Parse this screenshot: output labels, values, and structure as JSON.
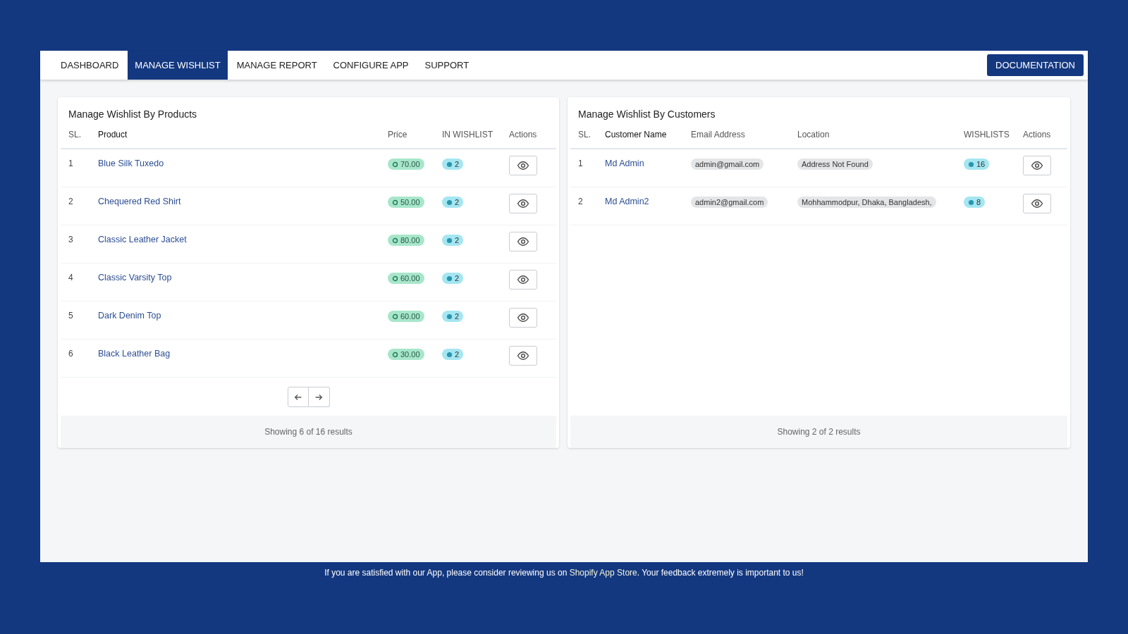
{
  "nav": {
    "tabs": [
      {
        "label": "DASHBOARD",
        "selected": false
      },
      {
        "label": "MANAGE WISHLIST",
        "selected": true
      },
      {
        "label": "MANAGE REPORT",
        "selected": false
      },
      {
        "label": "CONFIGURE APP",
        "selected": false
      },
      {
        "label": "SUPPORT",
        "selected": false
      }
    ],
    "documentation_button": "DOCUMENTATION"
  },
  "products_card": {
    "title": "Manage Wishlist By Products",
    "columns": [
      "SL.",
      "Product",
      "Price",
      "IN WISHLIST",
      "Actions"
    ],
    "rows": [
      {
        "sl": "1",
        "product": "Blue Silk Tuxedo",
        "price": "70.00",
        "in_wishlist": "2"
      },
      {
        "sl": "2",
        "product": "Chequered Red Shirt",
        "price": "50.00",
        "in_wishlist": "2"
      },
      {
        "sl": "3",
        "product": "Classic Leather Jacket",
        "price": "80.00",
        "in_wishlist": "2"
      },
      {
        "sl": "4",
        "product": "Classic Varsity Top",
        "price": "60.00",
        "in_wishlist": "2"
      },
      {
        "sl": "5",
        "product": "Dark Denim Top",
        "price": "60.00",
        "in_wishlist": "2"
      },
      {
        "sl": "6",
        "product": "Black Leather Bag",
        "price": "30.00",
        "in_wishlist": "2"
      }
    ],
    "footer": "Showing 6 of 16 results"
  },
  "customers_card": {
    "title": "Manage Wishlist By Customers",
    "columns": [
      "SL.",
      "Customer Name",
      "Email Address",
      "Location",
      "WISHLISTS",
      "Actions"
    ],
    "rows": [
      {
        "sl": "1",
        "name": "Md Admin",
        "email": "admin@gmail.com",
        "location": "Address Not Found",
        "wishlists": "16"
      },
      {
        "sl": "2",
        "name": "Md Admin2",
        "email": "admin2@gmail.com",
        "location": "Mohhammodpur, Dhaka, Bangladesh,",
        "wishlists": "8"
      }
    ],
    "footer": "Showing 2 of 2 results"
  },
  "bottom_note": {
    "before": "If you are satisfied with our App, please consider reviewing us on ",
    "link": "Shopify App Store",
    "after": ". Your feedback extremely is important to us!"
  }
}
